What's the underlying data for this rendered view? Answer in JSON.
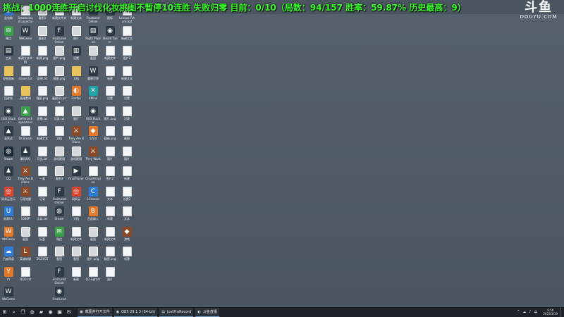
{
  "overlay": {
    "banner": "挑战：1000连胜开启讨伐化妆挑图不暂停10连胜 失败归零 目前：0/10（局数：94/157 胜率：59.87% 历史最高：9）"
  },
  "watermark": {
    "logo": "斗鱼",
    "domain": "DOUYU.COM"
  },
  "desktop": {
    "columns": [
      [
        {
          "label": "此电脑",
          "type": "blue",
          "glyph": "▣"
        },
        {
          "label": "微信",
          "type": "green",
          "glyph": "✉"
        },
        {
          "label": "工具",
          "type": "app",
          "glyph": "▤"
        },
        {
          "label": "控制面板",
          "type": "folder",
          "glyph": ""
        },
        {
          "label": "回收站",
          "type": "doc",
          "glyph": ""
        },
        {
          "label": "OBS Studio",
          "type": "app",
          "glyph": "◉"
        },
        {
          "label": "英伟达",
          "type": "app",
          "glyph": "▲"
        },
        {
          "label": "Steam",
          "type": "steam",
          "glyph": "◍"
        },
        {
          "label": "QQ",
          "type": "app",
          "glyph": "♟"
        },
        {
          "label": "网易云音乐",
          "type": "red",
          "glyph": "◎"
        },
        {
          "label": "网易UU",
          "type": "blue",
          "glyph": "U"
        },
        {
          "label": "WeGame",
          "type": "orange",
          "glyph": "W"
        },
        {
          "label": "百度网盘",
          "type": "blue",
          "glyph": "☁"
        },
        {
          "label": "YY",
          "type": "orange",
          "glyph": "Y"
        },
        {
          "label": "WeGame",
          "type": "app",
          "glyph": "W"
        }
      ],
      [
        {
          "label": "Steamcloud Launcher",
          "type": "doc",
          "glyph": ""
        },
        {
          "label": "WeGame",
          "type": "app",
          "glyph": "W"
        },
        {
          "label": "新建文本文档",
          "type": "doc",
          "glyph": ""
        },
        {
          "label": "steam.txt",
          "type": "doc",
          "glyph": ""
        },
        {
          "label": "直播素材",
          "type": "folder",
          "glyph": ""
        },
        {
          "label": "GeForce Experience",
          "type": "green",
          "glyph": "▲"
        },
        {
          "label": "1K-Steam",
          "type": "doc",
          "glyph": ""
        },
        {
          "label": "腾讯QQ",
          "type": "app",
          "glyph": "♟"
        },
        {
          "label": "They Are Billions",
          "type": "game",
          "glyph": "⚔"
        },
        {
          "label": "万国觉醒",
          "type": "game",
          "glyph": "⚔"
        },
        {
          "label": "1080P",
          "type": "doc",
          "glyph": ""
        },
        {
          "label": "截图",
          "type": "img",
          "glyph": ""
        },
        {
          "label": "英雄联盟",
          "type": "game",
          "glyph": "L"
        },
        {
          "label": "2023.txt",
          "type": "doc",
          "glyph": ""
        }
      ],
      [
        {
          "label": "截图1",
          "type": "img",
          "glyph": ""
        },
        {
          "label": "截图2",
          "type": "img",
          "glyph": ""
        },
        {
          "label": "新建.png",
          "type": "doc",
          "glyph": ""
        },
        {
          "label": "说明.txt",
          "type": "doc",
          "glyph": ""
        },
        {
          "label": "截图.png",
          "type": "doc",
          "glyph": ""
        },
        {
          "label": "直播.txt",
          "type": "doc",
          "glyph": ""
        },
        {
          "label": "新建文本",
          "type": "doc",
          "glyph": ""
        },
        {
          "label": "导出.txt",
          "type": "doc",
          "glyph": ""
        },
        {
          "label": "一盒",
          "type": "doc",
          "glyph": ""
        },
        {
          "label": "记录",
          "type": "doc",
          "glyph": ""
        },
        {
          "label": "文本.txt",
          "type": "doc",
          "glyph": ""
        },
        {
          "label": "标签",
          "type": "doc",
          "glyph": ""
        },
        {
          "label": "2023/01",
          "type": "doc",
          "glyph": ""
        }
      ],
      [
        {
          "label": "新建文件夹",
          "type": "doc",
          "glyph": ""
        },
        {
          "label": "Fractured Online",
          "type": "app",
          "glyph": "F"
        },
        {
          "label": "图片.png",
          "type": "img",
          "glyph": ""
        },
        {
          "label": "截图.png",
          "type": "img",
          "glyph": ""
        },
        {
          "label": "截图(2).png",
          "type": "img",
          "glyph": ""
        },
        {
          "label": "记录.txt",
          "type": "doc",
          "glyph": ""
        },
        {
          "label": "文档",
          "type": "doc",
          "glyph": ""
        },
        {
          "label": "游戏截图",
          "type": "img",
          "glyph": ""
        },
        {
          "label": "截图3",
          "type": "img",
          "glyph": ""
        },
        {
          "label": "Fractured Online",
          "type": "app",
          "glyph": "F"
        },
        {
          "label": "Steam",
          "type": "app",
          "glyph": "◍"
        },
        {
          "label": "微信",
          "type": "green",
          "glyph": "✉"
        },
        {
          "label": "截图",
          "type": "img",
          "glyph": ""
        },
        {
          "label": "Fractured Online",
          "type": "app",
          "glyph": "F"
        },
        {
          "label": "Fractured",
          "type": "app",
          "glyph": "◉"
        }
      ],
      [
        {
          "label": "新建文本",
          "type": "doc",
          "glyph": ""
        },
        {
          "label": "图片",
          "type": "img",
          "glyph": ""
        },
        {
          "label": "设置",
          "type": "app",
          "glyph": "▥"
        },
        {
          "label": "文档",
          "type": "folder",
          "glyph": ""
        },
        {
          "label": "Firefox",
          "type": "orange",
          "glyph": "◐"
        },
        {
          "label": "图片",
          "type": "img",
          "glyph": ""
        },
        {
          "label": "They Are Billions",
          "type": "game",
          "glyph": "⚔"
        },
        {
          "label": "游戏截图",
          "type": "img",
          "glyph": ""
        },
        {
          "label": "FinalPlayer",
          "type": "app",
          "glyph": "▶"
        },
        {
          "label": "网易云",
          "type": "red",
          "glyph": "◎"
        },
        {
          "label": "文档",
          "type": "doc",
          "glyph": ""
        },
        {
          "label": "新建文本",
          "type": "doc",
          "glyph": ""
        },
        {
          "label": "截图",
          "type": "img",
          "glyph": ""
        },
        {
          "label": "新建",
          "type": "doc",
          "glyph": ""
        }
      ],
      [
        {
          "label": "Fractured Online",
          "type": "app",
          "glyph": "F"
        },
        {
          "label": "Right Playlist",
          "type": "app",
          "glyph": "▤"
        },
        {
          "label": "截图",
          "type": "img",
          "glyph": ""
        },
        {
          "label": "魔兽世界",
          "type": "app",
          "glyph": "W"
        },
        {
          "label": "XMind",
          "type": "teal",
          "glyph": "✕"
        },
        {
          "label": "OBS Studio",
          "type": "app",
          "glyph": "◉"
        },
        {
          "label": "5/5/4",
          "type": "orange",
          "glyph": "◆"
        },
        {
          "label": "They Want",
          "type": "game",
          "glyph": "⚔"
        },
        {
          "label": "Cloud Engine",
          "type": "doc",
          "glyph": ""
        },
        {
          "label": "CCleaner",
          "type": "blue",
          "glyph": "C"
        },
        {
          "label": "百度输入",
          "type": "orange",
          "glyph": "B"
        },
        {
          "label": "截图",
          "type": "img",
          "glyph": ""
        },
        {
          "label": "图片.png",
          "type": "img",
          "glyph": ""
        },
        {
          "label": "Q2 Fighter",
          "type": "doc",
          "glyph": ""
        }
      ],
      [
        {
          "label": "图标",
          "type": "app",
          "glyph": "◍"
        },
        {
          "label": "Steam Tunes",
          "type": "app",
          "glyph": "◉"
        },
        {
          "label": "新建文本",
          "type": "doc",
          "glyph": ""
        },
        {
          "label": "新建",
          "type": "doc",
          "glyph": ""
        },
        {
          "label": "设置",
          "type": "doc",
          "glyph": ""
        },
        {
          "label": "图片.png",
          "type": "doc",
          "glyph": ""
        },
        {
          "label": "截图.png",
          "type": "doc",
          "glyph": ""
        },
        {
          "label": "图片",
          "type": "doc",
          "glyph": ""
        },
        {
          "label": "图片2",
          "type": "doc",
          "glyph": ""
        },
        {
          "label": "文本",
          "type": "doc",
          "glyph": ""
        },
        {
          "label": "新建",
          "type": "doc",
          "glyph": ""
        },
        {
          "label": "新建文本",
          "type": "doc",
          "glyph": ""
        },
        {
          "label": "截图.png",
          "type": "doc",
          "glyph": ""
        },
        {
          "label": "图片",
          "type": "doc",
          "glyph": ""
        }
      ],
      [
        {
          "label": "Lenovo Future.bat",
          "type": "doc",
          "glyph": ""
        },
        {
          "label": "新建文本",
          "type": "doc",
          "glyph": ""
        },
        {
          "label": "图片2",
          "type": "doc",
          "glyph": ""
        },
        {
          "label": "新建文本",
          "type": "doc",
          "glyph": ""
        },
        {
          "label": "设置",
          "type": "doc",
          "glyph": ""
        },
        {
          "label": "记录",
          "type": "doc",
          "glyph": ""
        },
        {
          "label": "截图",
          "type": "doc",
          "glyph": ""
        },
        {
          "label": "图片",
          "type": "doc",
          "glyph": ""
        },
        {
          "label": "新建",
          "type": "doc",
          "glyph": ""
        },
        {
          "label": "设置2",
          "type": "doc",
          "glyph": ""
        },
        {
          "label": "文本",
          "type": "doc",
          "glyph": ""
        },
        {
          "label": "游戏",
          "type": "game",
          "glyph": "◆"
        },
        {
          "label": "新建",
          "type": "doc",
          "glyph": ""
        }
      ]
    ]
  },
  "taskbar": {
    "tasks": [
      {
        "label": "截图并打开文件",
        "icon": "▣"
      },
      {
        "label": "OBS 29.1.3 (64-bit)",
        "icon": "◉"
      },
      {
        "label": "JustProRecord",
        "icon": "▤"
      },
      {
        "label": "斗鱼直播",
        "icon": "◐"
      }
    ],
    "tray": [
      "^",
      "☁",
      "♪",
      "中"
    ],
    "time": "9:50",
    "date": "2023/3/19"
  }
}
